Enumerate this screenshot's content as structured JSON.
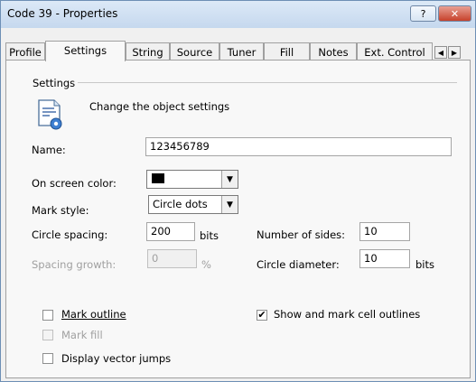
{
  "window": {
    "title": "Code 39 - Properties",
    "help_glyph": "?",
    "close_glyph": "✕"
  },
  "tabs": [
    {
      "label": "Profile"
    },
    {
      "label": "Settings"
    },
    {
      "label": "String"
    },
    {
      "label": "Source"
    },
    {
      "label": "Tuner"
    },
    {
      "label": "Fill"
    },
    {
      "label": "Notes"
    },
    {
      "label": "Ext. Control"
    }
  ],
  "tab_scroll": {
    "left": "◀",
    "right": "▶"
  },
  "active_tab": "Settings",
  "group": {
    "title": "Settings",
    "subtitle": "Change the object settings"
  },
  "fields": {
    "name": {
      "label": "Name:",
      "value": "123456789"
    },
    "on_screen_color": {
      "label": "On screen color:",
      "value_color": "#000000"
    },
    "mark_style": {
      "label": "Mark style:",
      "value": "Circle dots"
    },
    "circle_spacing": {
      "label": "Circle spacing:",
      "value": "200",
      "unit": "bits"
    },
    "spacing_growth": {
      "label": "Spacing growth:",
      "value": "0",
      "unit": "%"
    },
    "number_of_sides": {
      "label": "Number of sides:",
      "value": "10"
    },
    "circle_diameter": {
      "label": "Circle diameter:",
      "value": "10",
      "unit": "bits"
    }
  },
  "checkboxes": {
    "mark_outline": {
      "label": "Mark outline",
      "checked": false
    },
    "mark_fill": {
      "label": "Mark fill",
      "checked": false,
      "disabled": true
    },
    "display_vector_jumps": {
      "label": "Display vector jumps",
      "checked": false
    },
    "show_cell_outlines": {
      "label": "Show and mark cell outlines",
      "checked": true,
      "mark": "✔"
    }
  },
  "icons": {
    "dropdown_arrow": "▼"
  }
}
